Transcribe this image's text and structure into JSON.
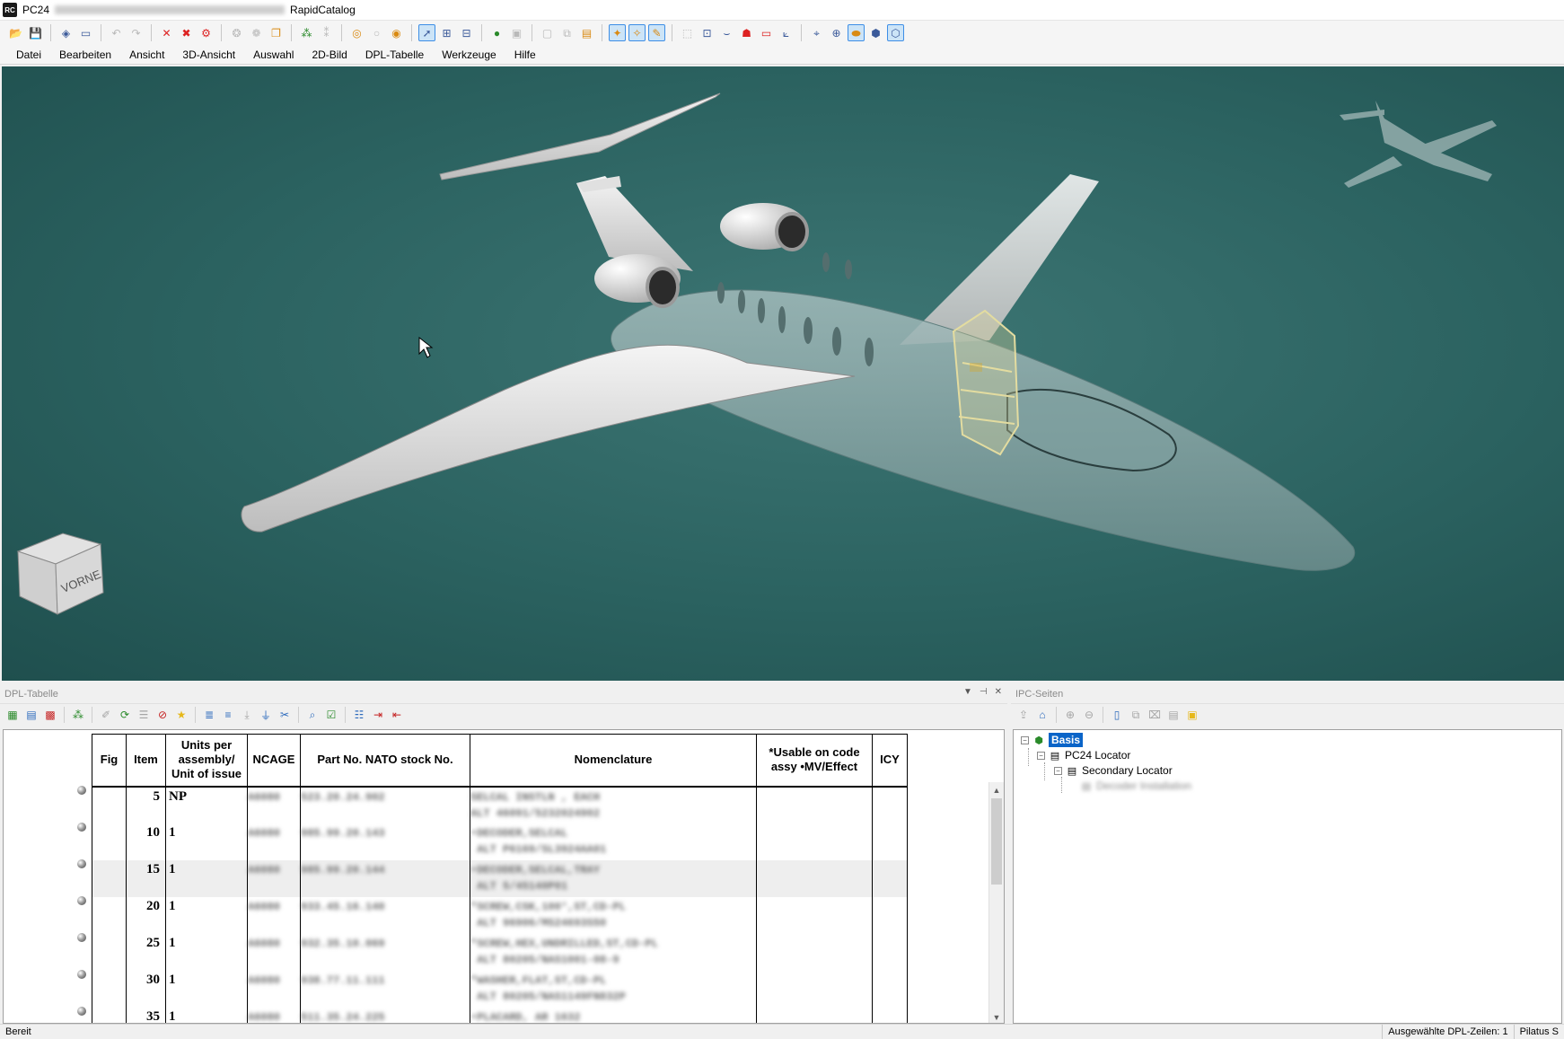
{
  "window": {
    "app_short": "PC24",
    "app_name": "RapidCatalog",
    "app_icon_label": "RC"
  },
  "toolbar": {
    "icons": [
      "open-icon",
      "save-icon",
      "eraser-icon",
      "monitor-icon",
      "undo-icon",
      "redo-icon",
      "delete-icon",
      "delete-all-icon",
      "settings-icon",
      "group-icon",
      "ungroup-icon",
      "copy-icon",
      "link-icon",
      "unlink-icon",
      "circle-select-icon",
      "circle-icon",
      "circle-add-icon",
      "pointer-icon",
      "select-tree-icon",
      "select-parent-icon",
      "sphere-icon",
      "cube-icon",
      "page-icon",
      "page-copy-icon",
      "folder-icon",
      "hotspot-icon",
      "hotspot-move-icon",
      "hotspot-edit-icon",
      "frame-icon",
      "zoom-frame-icon",
      "baseline-icon",
      "person-icon",
      "rect-icon",
      "axis-icon",
      "globe-net-icon",
      "globe-icon",
      "disk-icon",
      "box-3d-icon",
      "cube-view-icon"
    ]
  },
  "menu": {
    "items": [
      "Datei",
      "Bearbeiten",
      "Ansicht",
      "3D-Ansicht",
      "Auswahl",
      "2D-Bild",
      "DPL-Tabelle",
      "Werkzeuge",
      "Hilfe"
    ]
  },
  "viewport": {
    "view_cube_label": "VORNE",
    "background_color": "#2e6563"
  },
  "dpl": {
    "title": "DPL-Tabelle",
    "headers": {
      "fig": "Fig",
      "item": "Item",
      "units": "Units per assembly/ Unit of issue",
      "ncage": "NCAGE",
      "partno": "Part No. NATO stock No.",
      "nomenclature": "Nomenclature",
      "usable": "*Usable on code assy •MV/Effect",
      "icy": "ICY"
    },
    "rows": [
      {
        "item": "5",
        "units": "NP",
        "ncage": "A6080",
        "part": "523.20.24.902",
        "nom1": "SELCAL INSTLN , EACH",
        "nom2": "ALT 46091/5232024902"
      },
      {
        "item": "10",
        "units": "1",
        "ncage": "A6080",
        "part": "985.99.20.143",
        "nom1": "•DECODER,SELCAL",
        "nom2": " ALT P6169/SL3924AA01"
      },
      {
        "item": "15",
        "units": "1",
        "ncage": "A6080",
        "part": "985.99.20.144",
        "nom1": "•DECODER,SELCAL,TRAY",
        "nom2": " ALT 5/45140P01"
      },
      {
        "item": "20",
        "units": "1",
        "ncage": "A6080",
        "part": "933.45.16.140",
        "nom1": "*SCREW,CSK,100°,ST,CD-PL",
        "nom2": " ALT 96906/MS24693S50"
      },
      {
        "item": "25",
        "units": "1",
        "ncage": "A6080",
        "part": "932.35.10.069",
        "nom1": "*SCREW,HEX,UNDRILLED,ST,CD-PL",
        "nom2": " ALT 80205/NAS1001-08-9"
      },
      {
        "item": "30",
        "units": "1",
        "ncage": "A6080",
        "part": "938.77.11.111",
        "nom1": "*WASHER,FLAT,ST,CD-PL",
        "nom2": " ALT 80205/NAS1149FN832P"
      },
      {
        "item": "35",
        "units": "1",
        "ncage": "A6080",
        "part": "511.35.24.225",
        "nom1": "•PLACARD, AR 1632",
        "nom2": ""
      }
    ]
  },
  "ipc": {
    "title": "IPC-Seiten",
    "tree": {
      "root": "Basis",
      "child": "PC24 Locator",
      "grandchild": "Secondary Locator",
      "leaf": "Decoder Installation"
    }
  },
  "status": {
    "left": "Bereit",
    "selected": "Ausgewählte DPL-Zeilen: 1",
    "right": "Pilatus S"
  }
}
